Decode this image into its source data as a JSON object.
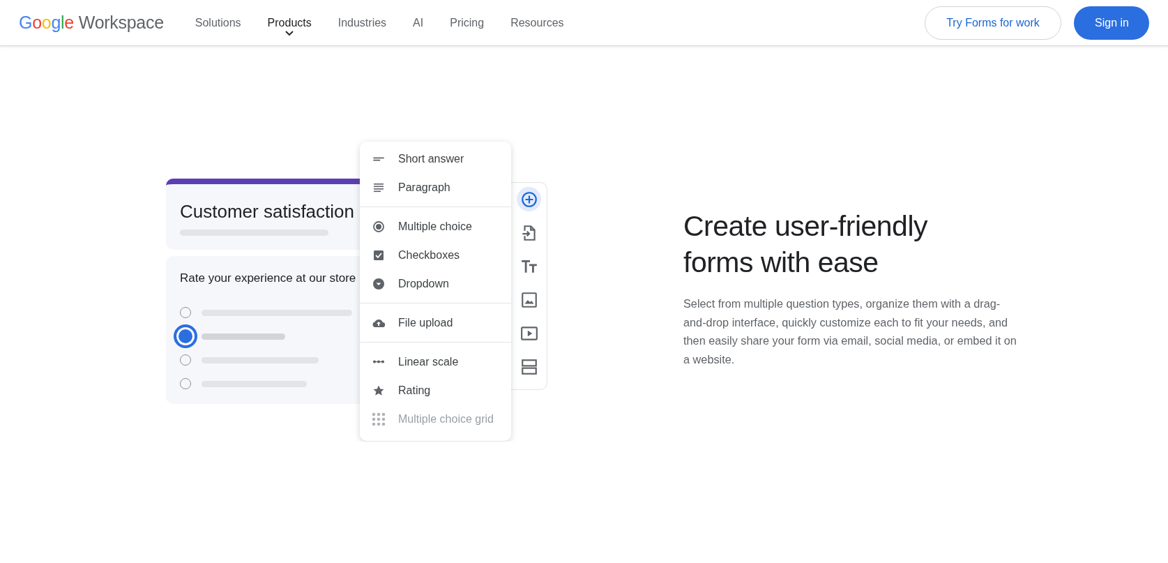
{
  "header": {
    "logo": {
      "brand": "Google",
      "product": "Workspace"
    },
    "nav": [
      {
        "label": "Solutions",
        "selected": false
      },
      {
        "label": "Products",
        "selected": true
      },
      {
        "label": "Industries",
        "selected": false
      },
      {
        "label": "AI",
        "selected": false
      },
      {
        "label": "Pricing",
        "selected": false
      },
      {
        "label": "Resources",
        "selected": false
      }
    ],
    "buttons": [
      {
        "label": "Try Forms for work",
        "kind": "outline"
      },
      {
        "label": "Sign in",
        "kind": "filled"
      }
    ]
  },
  "form_preview": {
    "title": "Customer satisfaction",
    "question": "Rate your experience at our store",
    "options": [
      {
        "selected": false
      },
      {
        "selected": true
      },
      {
        "selected": false
      },
      {
        "selected": false
      }
    ]
  },
  "question_menu": {
    "groups": [
      {
        "items": [
          {
            "label": "Short answer",
            "kind": "short",
            "disabled": false
          },
          {
            "label": "Paragraph",
            "kind": "paragraph",
            "disabled": false
          }
        ]
      },
      {
        "items": [
          {
            "label": "Multiple choice",
            "kind": "radio",
            "disabled": false
          },
          {
            "label": "Checkboxes",
            "kind": "checkbox",
            "disabled": false
          },
          {
            "label": "Dropdown",
            "kind": "dropdown",
            "disabled": false
          }
        ]
      },
      {
        "items": [
          {
            "label": "File upload",
            "kind": "upload",
            "disabled": false
          }
        ]
      },
      {
        "items": [
          {
            "label": "Linear scale",
            "kind": "scale",
            "disabled": false
          },
          {
            "label": "Rating",
            "kind": "star",
            "disabled": false
          },
          {
            "label": "Multiple choice grid",
            "kind": "grid",
            "disabled": true
          }
        ]
      }
    ]
  },
  "toolbar": [
    {
      "kind": "add",
      "selected": true
    },
    {
      "kind": "import",
      "selected": false
    },
    {
      "kind": "text",
      "selected": false
    },
    {
      "kind": "image",
      "selected": false
    },
    {
      "kind": "video",
      "selected": false
    },
    {
      "kind": "section",
      "selected": false
    }
  ],
  "hero": {
    "heading": "Create user-friendly forms with ease",
    "body": "Select from multiple question types, organize them with a drag-and-drop interface, quickly customize each to fit your needs, and then easily share your form via email, social media, or embed it on a website."
  }
}
